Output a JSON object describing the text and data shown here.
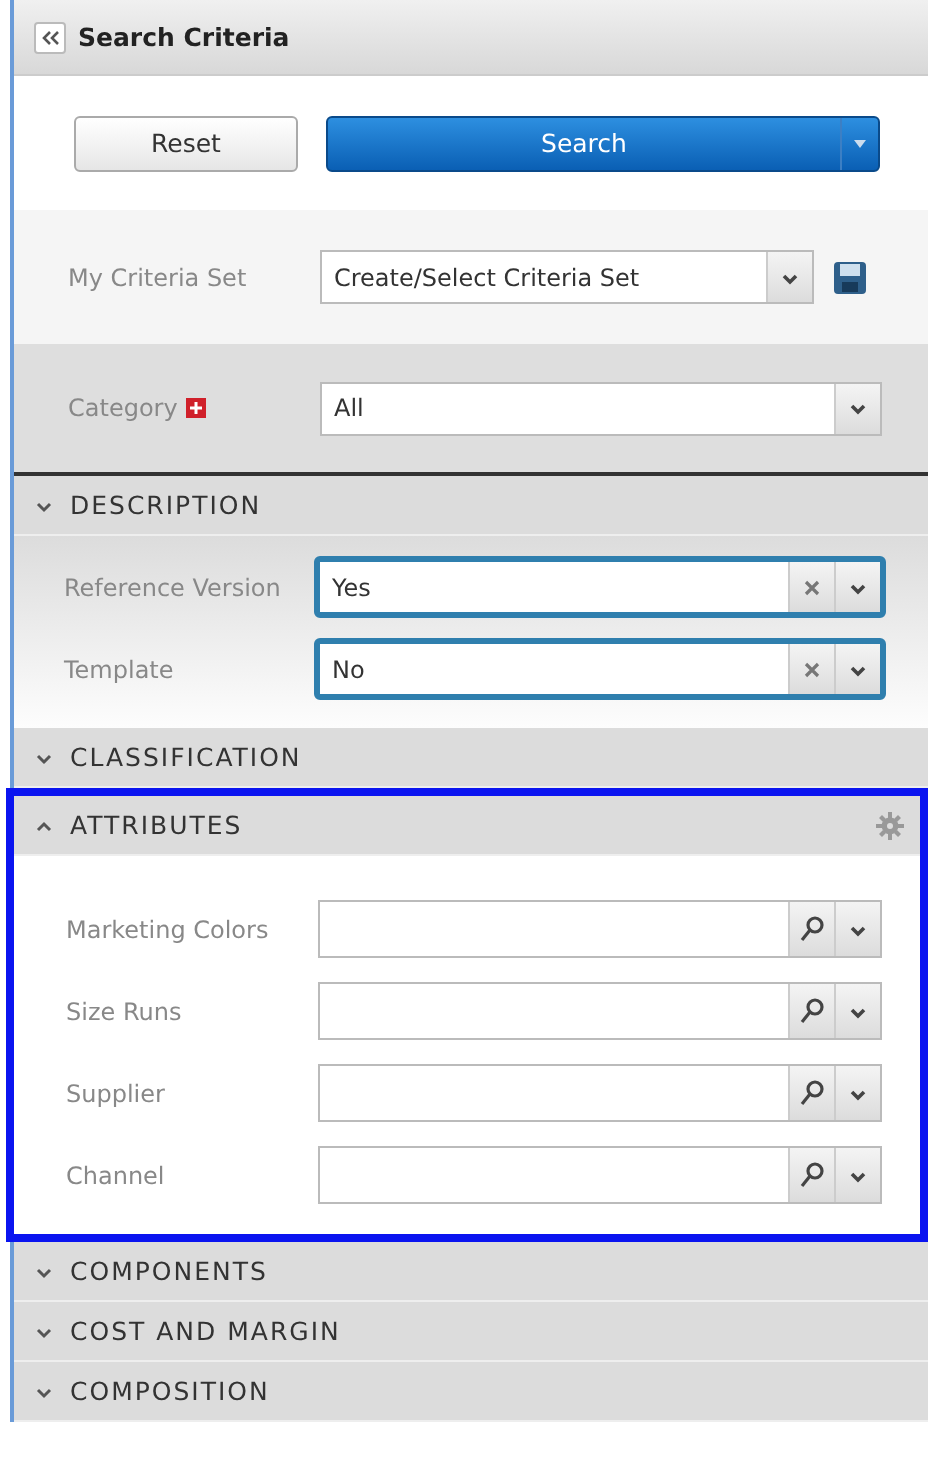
{
  "panel": {
    "title": "Search Criteria"
  },
  "buttons": [
    {
      "label": "Reset",
      "kind": "plain"
    },
    {
      "label": "Search",
      "kind": "primary"
    }
  ],
  "criteria_set": {
    "label": "My Criteria Set",
    "value": "Create/Select Criteria Set"
  },
  "category": {
    "label": "Category",
    "required": true,
    "value": "All"
  },
  "sections": [
    {
      "title": "DESCRIPTION",
      "arrow_up": false,
      "highlighted": false,
      "fields": [
        {
          "label": "Reference Version",
          "value": "Yes",
          "kind": "clearable",
          "focused": true
        },
        {
          "label": "Template",
          "value": "No",
          "kind": "clearable",
          "focused": true
        }
      ]
    },
    {
      "title": "CLASSIFICATION",
      "arrow_up": false,
      "highlighted": false
    },
    {
      "title": "ATTRIBUTES",
      "arrow_up": true,
      "highlighted": true,
      "settings": true,
      "fields": [
        {
          "label": "Marketing Colors",
          "kind": "lookup",
          "focused": false
        },
        {
          "label": "Size Runs",
          "kind": "lookup",
          "focused": false
        },
        {
          "label": "Supplier",
          "kind": "lookup",
          "focused": false
        },
        {
          "label": "Channel",
          "kind": "lookup",
          "focused": false
        }
      ]
    },
    {
      "title": "COMPONENTS",
      "arrow_up": false,
      "highlighted": false
    },
    {
      "title": "COST AND MARGIN",
      "arrow_up": false,
      "highlighted": false
    },
    {
      "title": "COMPOSITION",
      "arrow_up": false,
      "highlighted": false
    }
  ]
}
